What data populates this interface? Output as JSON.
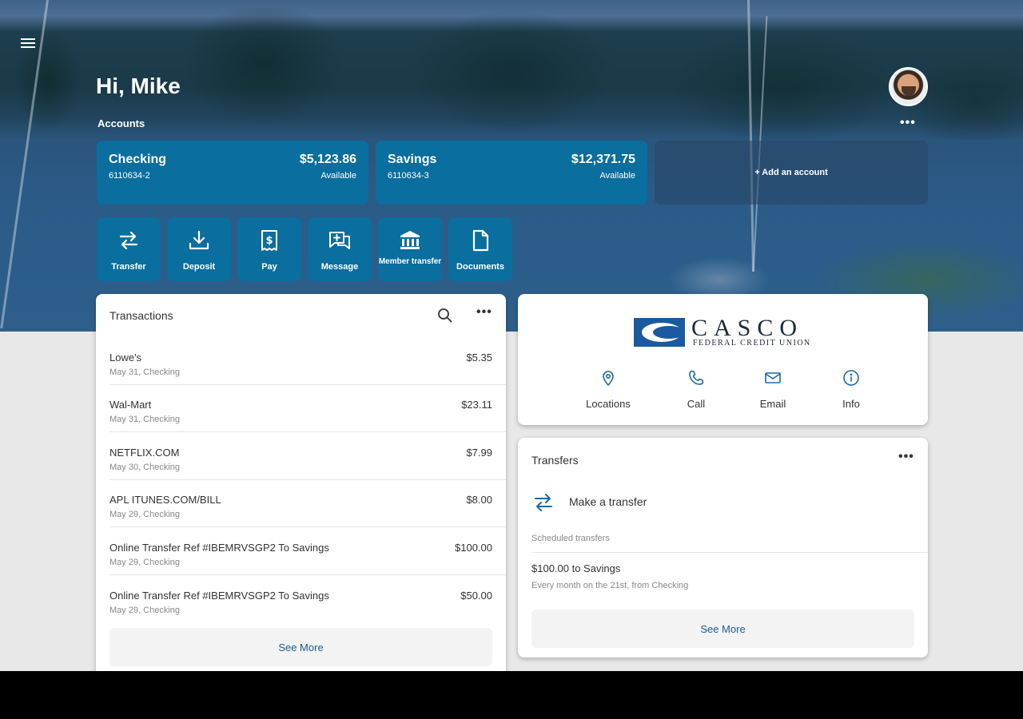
{
  "header": {
    "greeting": "Hi, Mike",
    "accounts_label": "Accounts",
    "avatar_more": "•••"
  },
  "accounts": [
    {
      "name": "Checking",
      "number": "6110634-2",
      "balance": "$5,123.86",
      "status": "Available"
    },
    {
      "name": "Savings",
      "number": "6110634-3",
      "balance": "$12,371.75",
      "status": "Available"
    }
  ],
  "add_account_label": "+ Add an account",
  "actions": [
    {
      "label": "Transfer",
      "icon": "transfer-icon"
    },
    {
      "label": "Deposit",
      "icon": "deposit-icon"
    },
    {
      "label": "Pay",
      "icon": "pay-icon"
    },
    {
      "label": "Message",
      "icon": "message-icon"
    },
    {
      "label": "Member transfer",
      "icon": "bank-icon"
    },
    {
      "label": "Documents",
      "icon": "document-icon"
    }
  ],
  "transactions": {
    "title": "Transactions",
    "more": "•••",
    "see_more": "See More",
    "rows": [
      {
        "description": "Lowe's",
        "meta": "May 31, Checking",
        "amount": "$5.35"
      },
      {
        "description": "Wal-Mart",
        "meta": "May 31, Checking",
        "amount": "$23.11"
      },
      {
        "description": "NETFLIX.COM",
        "meta": "May 30, Checking",
        "amount": "$7.99"
      },
      {
        "description": "APL ITUNES.COM/BILL",
        "meta": "May 29, Checking",
        "amount": "$8.00"
      },
      {
        "description": "Online Transfer Ref #IBEMRVSGP2 To Savings",
        "meta": "May 29, Checking",
        "amount": "$100.00"
      },
      {
        "description": "Online Transfer Ref #IBEMRVSGP2 To Savings",
        "meta": "May 29, Checking",
        "amount": "$50.00"
      }
    ]
  },
  "credit_union": {
    "logo_word": "CASCO",
    "logo_sub": "FEDERAL CREDIT UNION",
    "actions": [
      {
        "label": "Locations",
        "icon": "location-pin-icon"
      },
      {
        "label": "Call",
        "icon": "phone-icon"
      },
      {
        "label": "Email",
        "icon": "email-icon"
      },
      {
        "label": "Info",
        "icon": "info-icon"
      }
    ]
  },
  "transfers": {
    "title": "Transfers",
    "more": "•••",
    "make_transfer": "Make a transfer",
    "scheduled_label": "Scheduled transfers",
    "scheduled": [
      {
        "title": "$100.00 to Savings",
        "subtitle": "Every month on the 21st, from Checking"
      }
    ],
    "see_more": "See More"
  },
  "colors": {
    "card_blue": "#0a6e9e",
    "link_blue": "#1a5d92",
    "icon_blue": "#1b6aa8"
  }
}
